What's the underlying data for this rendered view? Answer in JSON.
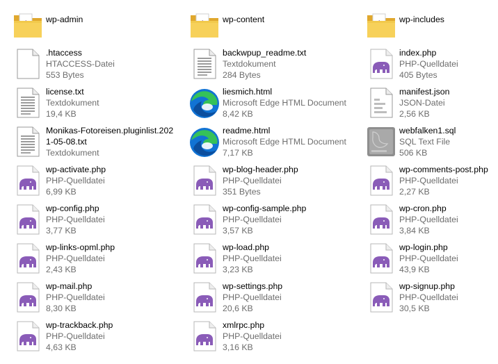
{
  "explorer": {
    "items": [
      {
        "name": "wp-admin",
        "icon": "folder-icon",
        "type": "",
        "size": ""
      },
      {
        "name": "wp-content",
        "icon": "folder-icon",
        "type": "",
        "size": ""
      },
      {
        "name": "wp-includes",
        "icon": "folder-icon",
        "type": "",
        "size": ""
      },
      {
        "name": ".htaccess",
        "icon": "blank-file-icon",
        "type": "HTACCESS-Datei",
        "size": "553 Bytes"
      },
      {
        "name": "backwpup_readme.txt",
        "icon": "text-file-icon",
        "type": "Textdokument",
        "size": "284 Bytes"
      },
      {
        "name": "index.php",
        "icon": "php-elephant-icon",
        "type": "PHP-Quelldatei",
        "size": "405 Bytes"
      },
      {
        "name": "license.txt",
        "icon": "text-file-icon",
        "type": "Textdokument",
        "size": "19,4 KB"
      },
      {
        "name": "liesmich.html",
        "icon": "edge-icon",
        "type": "Microsoft Edge HTML Document",
        "size": "8,42 KB"
      },
      {
        "name": "manifest.json",
        "icon": "json-file-icon",
        "type": "JSON-Datei",
        "size": "2,56 KB"
      },
      {
        "name": "Monikas-Fotoreisen.pluginlist.2021-05-08.txt",
        "icon": "text-file-icon",
        "type": "Textdokument",
        "size": ""
      },
      {
        "name": "readme.html",
        "icon": "edge-icon",
        "type": "Microsoft Edge HTML Document",
        "size": "7,17 KB"
      },
      {
        "name": "webfalken1.sql",
        "icon": "sql-file-icon",
        "type": "SQL Text File",
        "size": "506 KB"
      },
      {
        "name": "wp-activate.php",
        "icon": "php-elephant-icon",
        "type": "PHP-Quelldatei",
        "size": "6,99 KB"
      },
      {
        "name": "wp-blog-header.php",
        "icon": "php-elephant-icon",
        "type": "PHP-Quelldatei",
        "size": "351 Bytes"
      },
      {
        "name": "wp-comments-post.php",
        "icon": "php-elephant-icon",
        "type": "PHP-Quelldatei",
        "size": "2,27 KB"
      },
      {
        "name": "wp-config.php",
        "icon": "php-elephant-icon",
        "type": "PHP-Quelldatei",
        "size": "3,77 KB"
      },
      {
        "name": "wp-config-sample.php",
        "icon": "php-elephant-icon",
        "type": "PHP-Quelldatei",
        "size": "3,57 KB"
      },
      {
        "name": "wp-cron.php",
        "icon": "php-elephant-icon",
        "type": "PHP-Quelldatei",
        "size": "3,84 KB"
      },
      {
        "name": "wp-links-opml.php",
        "icon": "php-elephant-icon",
        "type": "PHP-Quelldatei",
        "size": "2,43 KB"
      },
      {
        "name": "wp-load.php",
        "icon": "php-elephant-icon",
        "type": "PHP-Quelldatei",
        "size": "3,23 KB"
      },
      {
        "name": "wp-login.php",
        "icon": "php-elephant-icon",
        "type": "PHP-Quelldatei",
        "size": "43,9 KB"
      },
      {
        "name": "wp-mail.php",
        "icon": "php-elephant-icon",
        "type": "PHP-Quelldatei",
        "size": "8,30 KB"
      },
      {
        "name": "wp-settings.php",
        "icon": "php-elephant-icon",
        "type": "PHP-Quelldatei",
        "size": "20,6 KB"
      },
      {
        "name": "wp-signup.php",
        "icon": "php-elephant-icon",
        "type": "PHP-Quelldatei",
        "size": "30,5 KB"
      },
      {
        "name": "wp-trackback.php",
        "icon": "php-elephant-icon",
        "type": "PHP-Quelldatei",
        "size": "4,63 KB"
      },
      {
        "name": "xmlrpc.php",
        "icon": "php-elephant-icon",
        "type": "PHP-Quelldatei",
        "size": "3,16 KB"
      }
    ]
  },
  "colors": {
    "folder": "#f2c94c",
    "folder_back": "#e0a82e",
    "php_purple": "#8a5cb8",
    "edge_blue": "#1173d4",
    "edge_green": "#35c159",
    "secondary_text": "#6d6d6d"
  }
}
